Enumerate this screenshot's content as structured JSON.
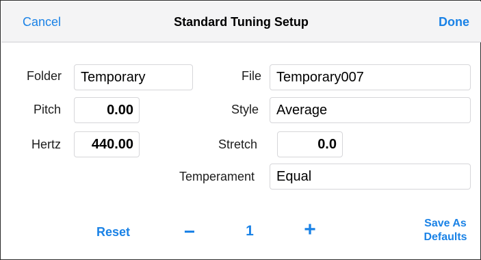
{
  "navbar": {
    "cancel_label": "Cancel",
    "title": "Standard Tuning Setup",
    "done_label": "Done"
  },
  "form": {
    "folder": {
      "label": "Folder",
      "value": "Temporary"
    },
    "file": {
      "label": "File",
      "value": "Temporary007"
    },
    "pitch": {
      "label": "Pitch",
      "value": "0.00"
    },
    "style": {
      "label": "Style",
      "value": "Average"
    },
    "hertz": {
      "label": "Hertz",
      "value": "440.00"
    },
    "stretch": {
      "label": "Stretch",
      "value": "0.0"
    },
    "temperament": {
      "label": "Temperament",
      "value": "Equal"
    }
  },
  "bottom": {
    "reset_label": "Reset",
    "minus_label": "−",
    "count": "1",
    "plus_label": "+",
    "save_line1": "Save As",
    "save_line2": "Defaults"
  },
  "colors": {
    "accent": "#1a82e6",
    "navbar_bg": "#f4f4f5",
    "field_border": "#d6d6d9"
  }
}
